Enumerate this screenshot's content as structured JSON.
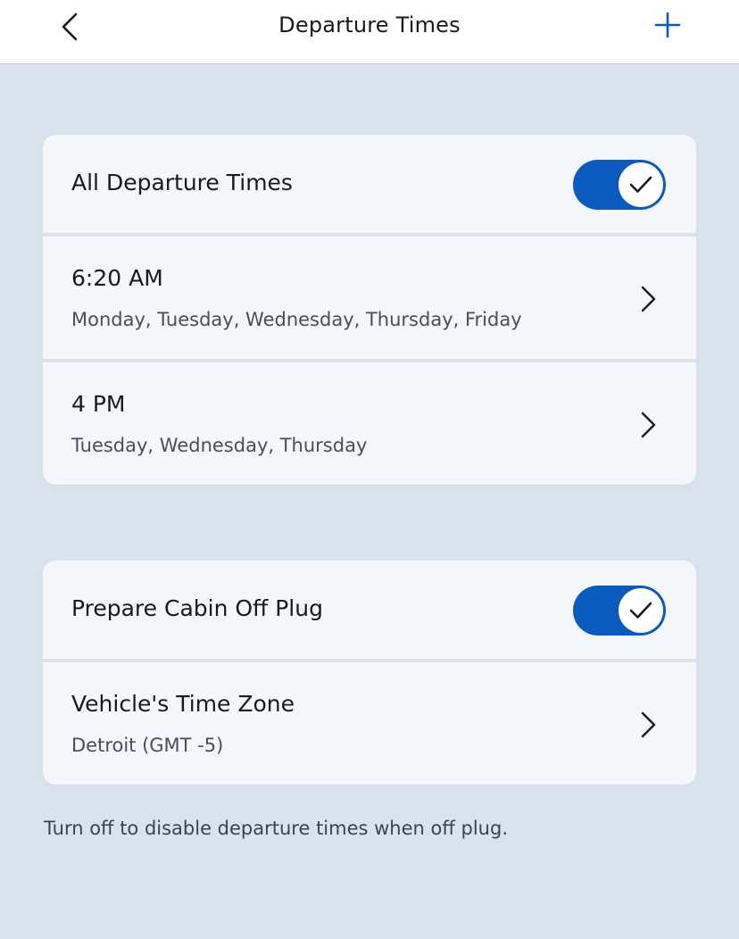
{
  "header": {
    "title": "Departure Times",
    "back_icon": "chevron-left-icon",
    "add_icon": "plus-icon"
  },
  "colors": {
    "accent": "#0a5bbf",
    "background": "#d9e3ee",
    "card": "#f3f6fa",
    "header": "#ffffff"
  },
  "departures": {
    "all_label": "All Departure Times",
    "all_enabled": true,
    "items": [
      {
        "time": "6:20 AM",
        "days": "Monday, Tuesday, Wednesday, Thursday, Friday"
      },
      {
        "time": "4 PM",
        "days": "Tuesday, Wednesday, Thursday"
      }
    ]
  },
  "settings": {
    "cabin_label": "Prepare Cabin Off Plug",
    "cabin_enabled": true,
    "timezone_label": "Vehicle's Time Zone",
    "timezone_value": "Detroit (GMT -5)"
  },
  "footer": {
    "note": "Turn off to disable departure times when off plug."
  }
}
